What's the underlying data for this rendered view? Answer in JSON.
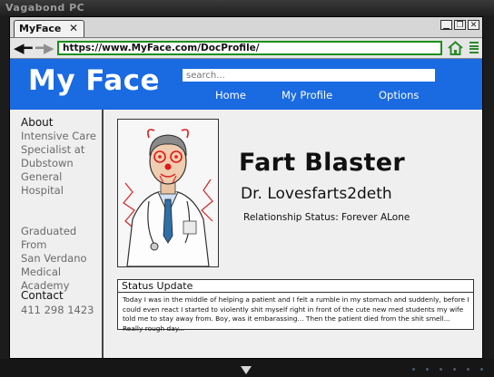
{
  "device": {
    "title": "Vagabond PC"
  },
  "browser": {
    "tab_label": "MyFace",
    "tab_close": "✕",
    "url": "https://www.MyFace.com/DocProfile/",
    "accent_color": "#1a8f1a"
  },
  "site": {
    "logo": "My Face",
    "search_placeholder": "search...",
    "nav": [
      "Home",
      "My Profile",
      "Options"
    ],
    "brand_color": "#1a6ae2"
  },
  "sidebar": {
    "about_heading": "About",
    "about_lines": [
      "Intensive Care",
      "Specialist at",
      "Dubstown",
      "General",
      "Hospital"
    ],
    "education_lines": [
      "Graduated From",
      "San Verdano",
      "Medical",
      "Academy"
    ],
    "contact_heading": "Contact",
    "contact_phone": "411 298 1423"
  },
  "profile": {
    "name": "Fart Blaster",
    "username": "Dr. Lovesfarts2deth",
    "relationship_label": "Relationship Status:",
    "relationship_value": "Forever ALone"
  },
  "status": {
    "title": "Status Update",
    "text": "Today I was in the middle of helping a patient and I felt a rumble in my stomach and suddenly, before I could even react I started to violently shit myself right in front of the cute new med students my wife told me to stay away from. Boy, was it embarassing... Then the patient died from the shit smell... Really rough day..."
  }
}
